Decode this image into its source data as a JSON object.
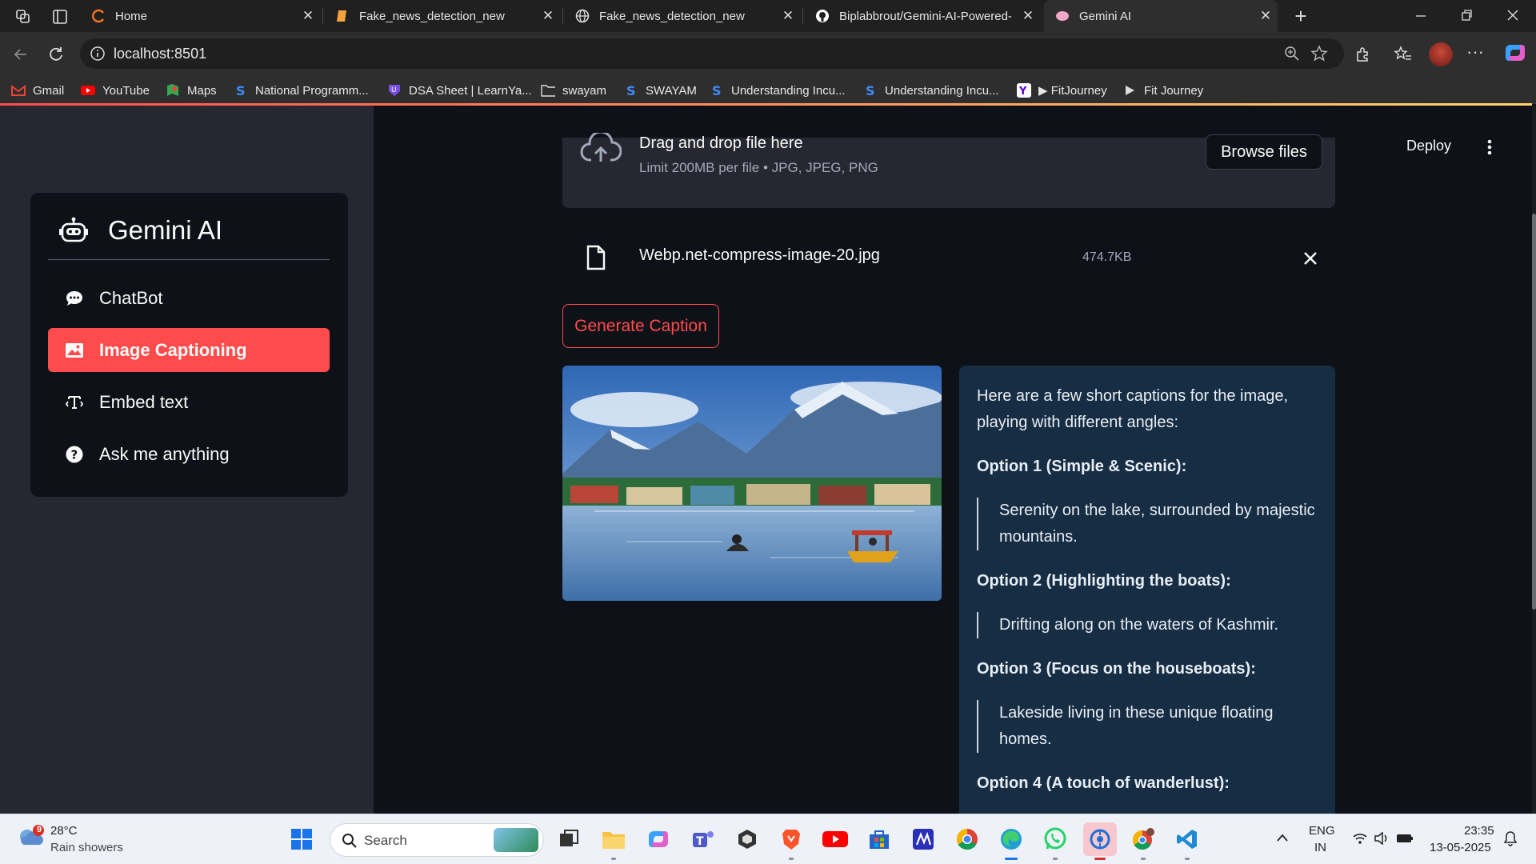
{
  "browser": {
    "tabs": [
      {
        "title": "Home"
      },
      {
        "title": "Fake_news_detection_new"
      },
      {
        "title": "Fake_news_detection_new"
      },
      {
        "title": "Biplabbrout/Gemini-AI-Powered-"
      },
      {
        "title": "Gemini AI"
      }
    ],
    "url": "localhost:8501",
    "bookmarks": [
      {
        "label": "Gmail"
      },
      {
        "label": "YouTube"
      },
      {
        "label": "Maps"
      },
      {
        "label": "National Programm..."
      },
      {
        "label": "DSA Sheet | LearnYa..."
      },
      {
        "label": "swayam"
      },
      {
        "label": "SWAYAM"
      },
      {
        "label": "Understanding Incu..."
      },
      {
        "label": "Understanding Incu..."
      },
      {
        "label": "▶ FitJourney"
      },
      {
        "label": "Fit Journey"
      }
    ]
  },
  "app": {
    "header": {
      "deploy_label": "Deploy"
    },
    "sidebar": {
      "title": "Gemini AI",
      "items": [
        {
          "label": "ChatBot",
          "icon": "chat-bubble-icon"
        },
        {
          "label": "Image Captioning",
          "icon": "image-icon",
          "active": true
        },
        {
          "label": "Embed text",
          "icon": "embed-icon"
        },
        {
          "label": "Ask me anything",
          "icon": "question-icon"
        }
      ]
    },
    "uploader": {
      "title": "Drag and drop file here",
      "limit": "Limit 200MB per file • JPG, JPEG, PNG",
      "browse_label": "Browse files",
      "file_name": "Webp.net-compress-image-20.jpg",
      "file_size": "474.7KB"
    },
    "generate_label": "Generate Caption",
    "caption": {
      "intro": "Here are a few short captions for the image, playing with different angles:",
      "options": [
        {
          "heading": "Option 1 (Simple & Scenic):",
          "text": "Serenity on the lake, surrounded by majestic mountains."
        },
        {
          "heading": "Option 2 (Highlighting the boats):",
          "text": "Drifting along on the waters of Kashmir."
        },
        {
          "heading": "Option 3 (Focus on the houseboats):",
          "text": "Lakeside living in these unique floating homes."
        },
        {
          "heading": "Option 4 (A touch of wanderlust):",
          "text": ""
        }
      ]
    },
    "accent_color": "#ff4b4b"
  },
  "taskbar": {
    "weather": {
      "temp": "28°C",
      "desc": "Rain showers",
      "badge": "9"
    },
    "search_label": "Search",
    "lang_line1": "ENG",
    "lang_line2": "IN",
    "time": "23:35",
    "date": "13-05-2025"
  }
}
